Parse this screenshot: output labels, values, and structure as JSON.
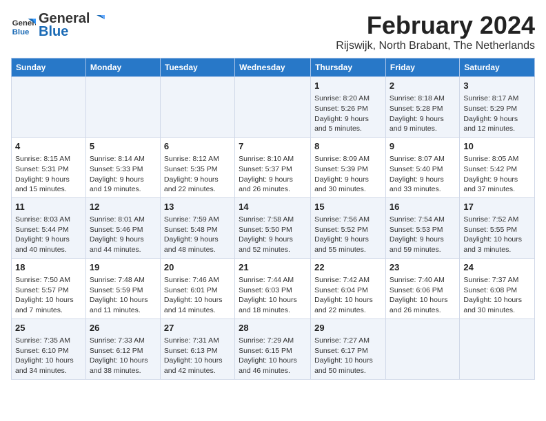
{
  "header": {
    "logo_general": "General",
    "logo_blue": "Blue",
    "month_year": "February 2024",
    "location": "Rijswijk, North Brabant, The Netherlands"
  },
  "days_of_week": [
    "Sunday",
    "Monday",
    "Tuesday",
    "Wednesday",
    "Thursday",
    "Friday",
    "Saturday"
  ],
  "weeks": [
    [
      {
        "day": "",
        "text": ""
      },
      {
        "day": "",
        "text": ""
      },
      {
        "day": "",
        "text": ""
      },
      {
        "day": "",
        "text": ""
      },
      {
        "day": "1",
        "text": "Sunrise: 8:20 AM\nSunset: 5:26 PM\nDaylight: 9 hours\nand 5 minutes."
      },
      {
        "day": "2",
        "text": "Sunrise: 8:18 AM\nSunset: 5:28 PM\nDaylight: 9 hours\nand 9 minutes."
      },
      {
        "day": "3",
        "text": "Sunrise: 8:17 AM\nSunset: 5:29 PM\nDaylight: 9 hours\nand 12 minutes."
      }
    ],
    [
      {
        "day": "4",
        "text": "Sunrise: 8:15 AM\nSunset: 5:31 PM\nDaylight: 9 hours\nand 15 minutes."
      },
      {
        "day": "5",
        "text": "Sunrise: 8:14 AM\nSunset: 5:33 PM\nDaylight: 9 hours\nand 19 minutes."
      },
      {
        "day": "6",
        "text": "Sunrise: 8:12 AM\nSunset: 5:35 PM\nDaylight: 9 hours\nand 22 minutes."
      },
      {
        "day": "7",
        "text": "Sunrise: 8:10 AM\nSunset: 5:37 PM\nDaylight: 9 hours\nand 26 minutes."
      },
      {
        "day": "8",
        "text": "Sunrise: 8:09 AM\nSunset: 5:39 PM\nDaylight: 9 hours\nand 30 minutes."
      },
      {
        "day": "9",
        "text": "Sunrise: 8:07 AM\nSunset: 5:40 PM\nDaylight: 9 hours\nand 33 minutes."
      },
      {
        "day": "10",
        "text": "Sunrise: 8:05 AM\nSunset: 5:42 PM\nDaylight: 9 hours\nand 37 minutes."
      }
    ],
    [
      {
        "day": "11",
        "text": "Sunrise: 8:03 AM\nSunset: 5:44 PM\nDaylight: 9 hours\nand 40 minutes."
      },
      {
        "day": "12",
        "text": "Sunrise: 8:01 AM\nSunset: 5:46 PM\nDaylight: 9 hours\nand 44 minutes."
      },
      {
        "day": "13",
        "text": "Sunrise: 7:59 AM\nSunset: 5:48 PM\nDaylight: 9 hours\nand 48 minutes."
      },
      {
        "day": "14",
        "text": "Sunrise: 7:58 AM\nSunset: 5:50 PM\nDaylight: 9 hours\nand 52 minutes."
      },
      {
        "day": "15",
        "text": "Sunrise: 7:56 AM\nSunset: 5:52 PM\nDaylight: 9 hours\nand 55 minutes."
      },
      {
        "day": "16",
        "text": "Sunrise: 7:54 AM\nSunset: 5:53 PM\nDaylight: 9 hours\nand 59 minutes."
      },
      {
        "day": "17",
        "text": "Sunrise: 7:52 AM\nSunset: 5:55 PM\nDaylight: 10 hours\nand 3 minutes."
      }
    ],
    [
      {
        "day": "18",
        "text": "Sunrise: 7:50 AM\nSunset: 5:57 PM\nDaylight: 10 hours\nand 7 minutes."
      },
      {
        "day": "19",
        "text": "Sunrise: 7:48 AM\nSunset: 5:59 PM\nDaylight: 10 hours\nand 11 minutes."
      },
      {
        "day": "20",
        "text": "Sunrise: 7:46 AM\nSunset: 6:01 PM\nDaylight: 10 hours\nand 14 minutes."
      },
      {
        "day": "21",
        "text": "Sunrise: 7:44 AM\nSunset: 6:03 PM\nDaylight: 10 hours\nand 18 minutes."
      },
      {
        "day": "22",
        "text": "Sunrise: 7:42 AM\nSunset: 6:04 PM\nDaylight: 10 hours\nand 22 minutes."
      },
      {
        "day": "23",
        "text": "Sunrise: 7:40 AM\nSunset: 6:06 PM\nDaylight: 10 hours\nand 26 minutes."
      },
      {
        "day": "24",
        "text": "Sunrise: 7:37 AM\nSunset: 6:08 PM\nDaylight: 10 hours\nand 30 minutes."
      }
    ],
    [
      {
        "day": "25",
        "text": "Sunrise: 7:35 AM\nSunset: 6:10 PM\nDaylight: 10 hours\nand 34 minutes."
      },
      {
        "day": "26",
        "text": "Sunrise: 7:33 AM\nSunset: 6:12 PM\nDaylight: 10 hours\nand 38 minutes."
      },
      {
        "day": "27",
        "text": "Sunrise: 7:31 AM\nSunset: 6:13 PM\nDaylight: 10 hours\nand 42 minutes."
      },
      {
        "day": "28",
        "text": "Sunrise: 7:29 AM\nSunset: 6:15 PM\nDaylight: 10 hours\nand 46 minutes."
      },
      {
        "day": "29",
        "text": "Sunrise: 7:27 AM\nSunset: 6:17 PM\nDaylight: 10 hours\nand 50 minutes."
      },
      {
        "day": "",
        "text": ""
      },
      {
        "day": "",
        "text": ""
      }
    ]
  ]
}
